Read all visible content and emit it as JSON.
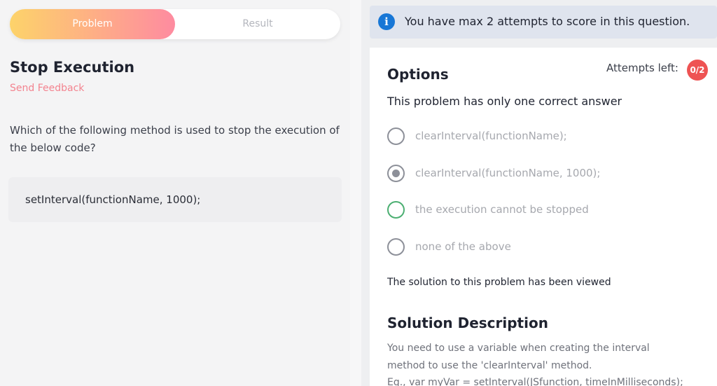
{
  "tabs": [
    {
      "label": "Problem",
      "active": true
    },
    {
      "label": "Result",
      "active": false
    }
  ],
  "problem": {
    "title": "Stop Execution",
    "feedback_link": "Send Feedback",
    "question": "Which of the following method is used to stop the execution of the below code?",
    "code": "setInterval(functionName, 1000);"
  },
  "banner": {
    "icon": "info-icon",
    "text": "You have max 2 attempts to score in this question."
  },
  "options_panel": {
    "title": "Options",
    "attempts_label": "Attempts left:",
    "attempts_value": "0/2",
    "instruction": "This problem has only one correct answer",
    "options": [
      {
        "label": "clearInterval(functionName);",
        "state": "unselected"
      },
      {
        "label": "clearInterval(functionName, 1000);",
        "state": "selected"
      },
      {
        "label": "the execution cannot be stopped",
        "state": "correct"
      },
      {
        "label": "none of the above",
        "state": "unselected"
      }
    ],
    "viewed_note": "The solution to this problem has been viewed"
  },
  "solution": {
    "title": "Solution Description",
    "lines": [
      "You need to use a variable when creating the interval",
      "method to use the 'clearInterval' method.",
      "Eg., var myVar = setInterval(JSfunction, timeInMilliseconds);"
    ]
  },
  "colors": {
    "tab_gradient_start": "#fdd36a",
    "tab_gradient_end": "#fe8ba0",
    "feedback": "#f3838f",
    "info_blue": "#1877d6",
    "badge_red": "#ee5353",
    "correct_green": "#4caf72"
  }
}
